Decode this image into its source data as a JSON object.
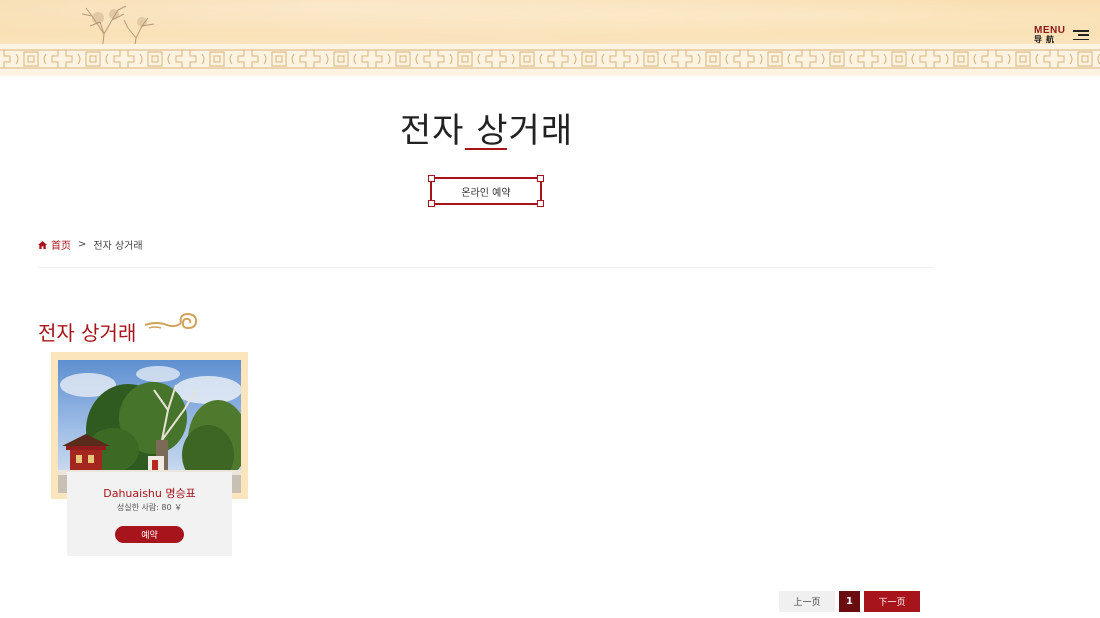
{
  "header": {
    "menu_en": "MENU",
    "menu_cn": "导航"
  },
  "page": {
    "title": "전자 상거래",
    "booking_button": "온라인 예약"
  },
  "breadcrumb": {
    "home": "首页",
    "separator": ">",
    "current": "전자 상거래"
  },
  "section": {
    "title": "전자 상거래"
  },
  "products": [
    {
      "name": "Dahuaishu 명승표",
      "price": "성실한 사람: 80 ￥",
      "button": "예약"
    }
  ],
  "pagination": {
    "prev": "上一页",
    "current_page": "1",
    "next": "下一页"
  },
  "colors": {
    "accent": "#a8141b",
    "banner": "#f7d9a8",
    "card_frame": "#fbe5bd"
  }
}
